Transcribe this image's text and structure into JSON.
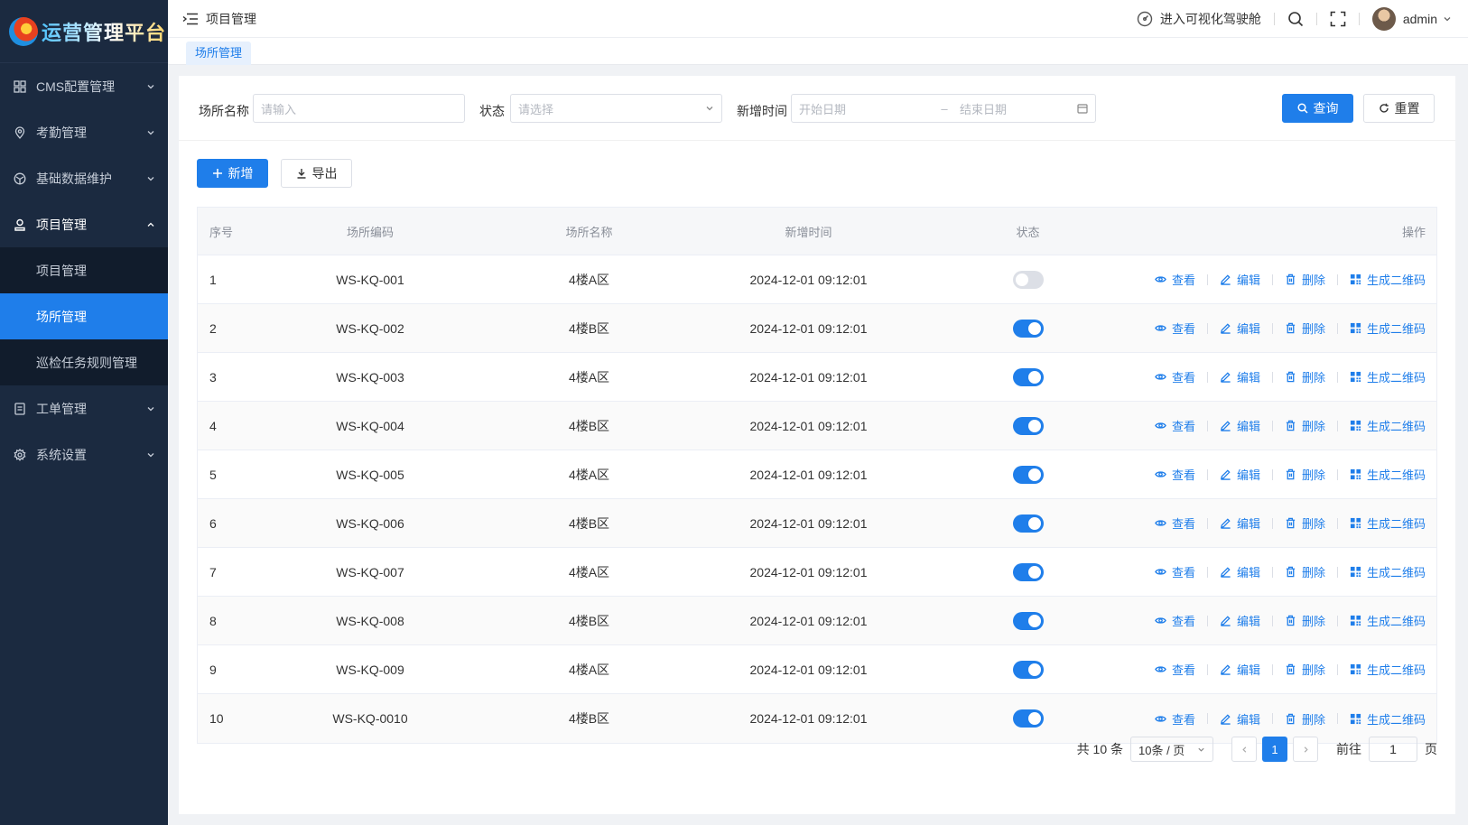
{
  "app": {
    "logo_text": "运营管理平台"
  },
  "sidebar": {
    "items": [
      {
        "label": "CMS配置管理",
        "icon": "grid-icon"
      },
      {
        "label": "考勤管理",
        "icon": "location-icon"
      },
      {
        "label": "基础数据维护",
        "icon": "database-icon"
      },
      {
        "label": "项目管理",
        "icon": "user-icon",
        "expanded": true,
        "children": [
          {
            "label": "项目管理"
          },
          {
            "label": "场所管理",
            "active": true
          },
          {
            "label": "巡检任务规则管理"
          }
        ]
      },
      {
        "label": "工单管理",
        "icon": "document-icon"
      },
      {
        "label": "系统设置",
        "icon": "settings-icon"
      }
    ]
  },
  "header": {
    "crumb": "项目管理",
    "cockpit_label": "进入可视化驾驶舱",
    "user": "admin"
  },
  "tags": {
    "active": "场所管理"
  },
  "filters": {
    "name_label": "场所名称",
    "name_placeholder": "请输入",
    "status_label": "状态",
    "status_placeholder": "请选择",
    "date_label": "新增时间",
    "date_start_placeholder": "开始日期",
    "date_sep": "–",
    "date_end_placeholder": "结束日期",
    "query_label": "查询",
    "reset_label": "重置"
  },
  "toolbar": {
    "add_label": "新增",
    "export_label": "导出"
  },
  "table": {
    "columns": [
      "序号",
      "场所编码",
      "场所名称",
      "新增时间",
      "状态",
      "操作"
    ],
    "ops": {
      "view": "查看",
      "edit": "编辑",
      "delete": "删除",
      "qrcode": "生成二维码"
    },
    "rows": [
      {
        "idx": "1",
        "code": "WS-KQ-001",
        "name": "4楼A区",
        "time": "2024-12-01 09:12:01",
        "enabled": false
      },
      {
        "idx": "2",
        "code": "WS-KQ-002",
        "name": "4楼B区",
        "time": "2024-12-01 09:12:01",
        "enabled": true
      },
      {
        "idx": "3",
        "code": "WS-KQ-003",
        "name": "4楼A区",
        "time": "2024-12-01 09:12:01",
        "enabled": true
      },
      {
        "idx": "4",
        "code": "WS-KQ-004",
        "name": "4楼B区",
        "time": "2024-12-01 09:12:01",
        "enabled": true
      },
      {
        "idx": "5",
        "code": "WS-KQ-005",
        "name": "4楼A区",
        "time": "2024-12-01 09:12:01",
        "enabled": true
      },
      {
        "idx": "6",
        "code": "WS-KQ-006",
        "name": "4楼B区",
        "time": "2024-12-01 09:12:01",
        "enabled": true
      },
      {
        "idx": "7",
        "code": "WS-KQ-007",
        "name": "4楼A区",
        "time": "2024-12-01 09:12:01",
        "enabled": true
      },
      {
        "idx": "8",
        "code": "WS-KQ-008",
        "name": "4楼B区",
        "time": "2024-12-01 09:12:01",
        "enabled": true
      },
      {
        "idx": "9",
        "code": "WS-KQ-009",
        "name": "4楼A区",
        "time": "2024-12-01 09:12:01",
        "enabled": true
      },
      {
        "idx": "10",
        "code": "WS-KQ-0010",
        "name": "4楼B区",
        "time": "2024-12-01 09:12:01",
        "enabled": true
      }
    ]
  },
  "pagination": {
    "total_text": "共 10 条",
    "page_size": "10条 / 页",
    "current_page": "1",
    "goto_label": "前往",
    "goto_value": "1",
    "page_unit": "页"
  },
  "colors": {
    "primary": "#1f7eea",
    "sidebar_bg": "#1b2a40",
    "submenu_bg": "#111c2c"
  }
}
